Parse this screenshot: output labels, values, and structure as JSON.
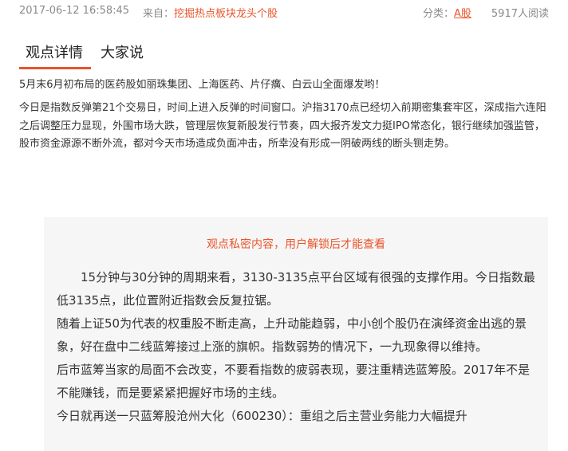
{
  "meta": {
    "date": "2017-06-12 16:58:45",
    "source_label": "来自：",
    "source_link": "挖掘热点板块龙头个股",
    "category_label": "分类：",
    "category_value": "A股",
    "reads": "5917人阅读"
  },
  "tabs": [
    {
      "label": "观点详情",
      "active": true
    },
    {
      "label": "大家说",
      "active": false
    }
  ],
  "article": {
    "para1": "5月末6月初布局的医药股如丽珠集团、上海医药、片仔癀、白云山全面爆发哟！",
    "para2": "今日是指数反弹第21个交易日，时间上进入反弹的时间窗口。沪指3170点已经切入前期密集套牢区，深成指六连阳之后调整压力显现，外围市场大跌，管理层恢复新股发行节奏，四大报齐发文力挺IPO常态化，银行继续加强监管，股市资金源源不断外流，都对今天市场造成负面冲击，所幸没有形成一阴破两线的断头铡走势。"
  },
  "locked": {
    "notice": "观点私密内容，用户解锁后才能查看",
    "para1": "15分钟与30分钟的周期来看，3130-3135点平台区域有很强的支撑作用。今日指数最低3135点，此位置附近指数会反复拉锯。",
    "para2": "随着上证50为代表的权重股不断走高，上升动能趋弱，中小创个股仍在演绎资金出逃的景象，好在盘中二线蓝筹接过上涨的旗帜。指数弱势的情况下，一九现象得以维持。",
    "para3": "后市蓝筹当家的局面不会改变，不要看指数的疲弱表现，要注重精选蓝筹股。2017年不是不能赚钱，而是要紧紧把握好市场的主线。",
    "para4": "今日就再送一只蓝筹股沧州大化（600230）：重组之后主营业务能力大幅提升"
  },
  "colors": {
    "accent": "#e8542a",
    "muted": "#8a8a8a",
    "locked_bg": "#f7f6f6"
  }
}
